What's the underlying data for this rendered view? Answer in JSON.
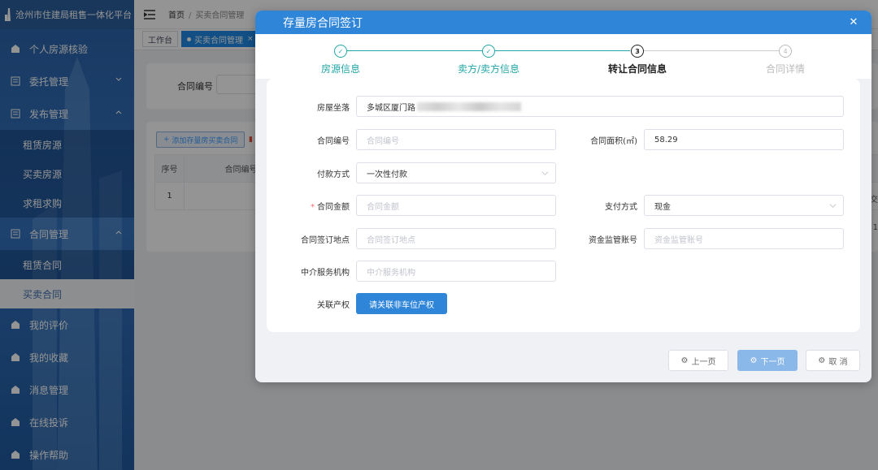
{
  "app": {
    "title": "沧州市住建局租售一体化平台"
  },
  "sidebar": {
    "items": [
      {
        "label": "个人房源核验",
        "icon": "building-icon"
      },
      {
        "label": "委托管理",
        "icon": "doc-icon",
        "expanded": false
      },
      {
        "label": "发布管理",
        "icon": "doc-icon",
        "expanded": true
      },
      {
        "label": "租赁房源"
      },
      {
        "label": "买卖房源"
      },
      {
        "label": "求租求购"
      },
      {
        "label": "合同管理",
        "icon": "doc-icon",
        "expanded": true
      },
      {
        "label": "租赁合同"
      },
      {
        "label": "买卖合同",
        "active": true
      },
      {
        "label": "我的评价",
        "icon": "building-icon"
      },
      {
        "label": "我的收藏",
        "icon": "building-icon"
      },
      {
        "label": "消息管理",
        "icon": "building-icon"
      },
      {
        "label": "在线投诉",
        "icon": "building-icon"
      },
      {
        "label": "操作帮助",
        "icon": "building-icon"
      }
    ]
  },
  "header": {
    "breadcrumb": [
      "首页",
      "买卖合同管理"
    ]
  },
  "tags": [
    {
      "label": "工作台",
      "active": false
    },
    {
      "label": "买卖合同管理",
      "active": true
    }
  ],
  "page": {
    "search_label": "合同编号",
    "add_button": "添加存量房买卖合同",
    "table_headers": [
      "序号",
      "合同编号"
    ],
    "table_row_index": "1",
    "right_edge": [
      "交",
      "1"
    ]
  },
  "dialog": {
    "title": "存量房合同签订",
    "steps": [
      {
        "label": "房源信息",
        "state": "done"
      },
      {
        "label": "卖方/卖方信息",
        "state": "done"
      },
      {
        "label": "转让合同信息",
        "state": "current",
        "num": "3"
      },
      {
        "label": "合同详情",
        "state": "wait",
        "num": "4"
      }
    ],
    "form": {
      "location": {
        "label": "房屋坐落",
        "value": "⁠多城区厦门路"
      },
      "contract_no": {
        "label": "合同编号",
        "placeholder": "合同编号"
      },
      "area": {
        "label": "合同面积(㎡)",
        "value": "58.29"
      },
      "pay_method": {
        "label": "付款方式",
        "value": "一次性付款"
      },
      "amount": {
        "label": "合同金额",
        "placeholder": "合同金额",
        "required": true
      },
      "pay_way": {
        "label": "支付方式",
        "value": "现金"
      },
      "sign_place": {
        "label": "合同签订地点",
        "placeholder": "合同签订地点"
      },
      "escrow_account": {
        "label": "资金监管账号",
        "placeholder": "资金监管账号"
      },
      "agency": {
        "label": "中介服务机构",
        "placeholder": "中介服务机构"
      },
      "property": {
        "label": "关联产权",
        "button": "请关联非车位产权"
      }
    },
    "footer": {
      "prev": "上一页",
      "next": "下一页",
      "cancel": "取 消"
    }
  },
  "colors": {
    "primary": "#2f86d9",
    "step_done": "#23a6a6",
    "sidebar": "#2a62a8",
    "required": "#f56c6c"
  }
}
